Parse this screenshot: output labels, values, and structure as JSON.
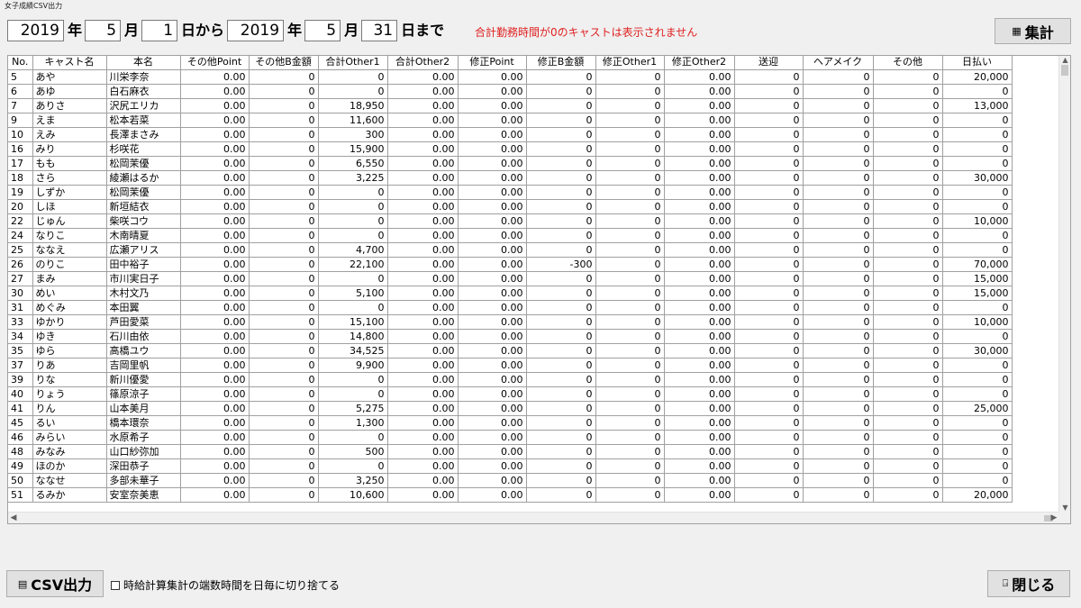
{
  "window": {
    "title": "女子成績CSV出力"
  },
  "date_range": {
    "from_year": "2019",
    "from_year_unit": "年",
    "from_month": "5",
    "from_month_unit": "月",
    "from_day": "1",
    "from_day_unit": "日から",
    "to_year": "2019",
    "to_year_unit": "年",
    "to_month": "5",
    "to_month_unit": "月",
    "to_day": "31",
    "to_day_unit": "日まで"
  },
  "warning": {
    "text": "合計勤務時間が0のキャストは表示されません",
    "color": "#e02020"
  },
  "buttons": {
    "aggregate": "集計",
    "csv": "CSV出力",
    "close": "閉じる"
  },
  "footer": {
    "truncate_label": "時給計算集計の端数時間を日毎に切り捨てる",
    "truncate_checked": false
  },
  "table": {
    "columns": [
      "No.",
      "キャスト名",
      "本名",
      "その他Point",
      "その他B金額",
      "合計Other1",
      "合計Other2",
      "修正Point",
      "修正B金額",
      "修正Other1",
      "修正Other2",
      "送迎",
      "ヘアメイク",
      "その他",
      "日払い"
    ],
    "rows": [
      [
        "5",
        "あや",
        "川栄李奈",
        "0.00",
        "0",
        "0",
        "0.00",
        "0.00",
        "0",
        "0",
        "0.00",
        "0",
        "0",
        "0",
        "20,000"
      ],
      [
        "6",
        "あゆ",
        "白石麻衣",
        "0.00",
        "0",
        "0",
        "0.00",
        "0.00",
        "0",
        "0",
        "0.00",
        "0",
        "0",
        "0",
        "0"
      ],
      [
        "7",
        "ありさ",
        "沢尻エリカ",
        "0.00",
        "0",
        "18,950",
        "0.00",
        "0.00",
        "0",
        "0",
        "0.00",
        "0",
        "0",
        "0",
        "13,000"
      ],
      [
        "9",
        "えま",
        "松本若菜",
        "0.00",
        "0",
        "11,600",
        "0.00",
        "0.00",
        "0",
        "0",
        "0.00",
        "0",
        "0",
        "0",
        "0"
      ],
      [
        "10",
        "えみ",
        "長澤まさみ",
        "0.00",
        "0",
        "300",
        "0.00",
        "0.00",
        "0",
        "0",
        "0.00",
        "0",
        "0",
        "0",
        "0"
      ],
      [
        "16",
        "みり",
        "杉咲花",
        "0.00",
        "0",
        "15,900",
        "0.00",
        "0.00",
        "0",
        "0",
        "0.00",
        "0",
        "0",
        "0",
        "0"
      ],
      [
        "17",
        "もも",
        "松岡茉優",
        "0.00",
        "0",
        "6,550",
        "0.00",
        "0.00",
        "0",
        "0",
        "0.00",
        "0",
        "0",
        "0",
        "0"
      ],
      [
        "18",
        "さら",
        "綾瀬はるか",
        "0.00",
        "0",
        "3,225",
        "0.00",
        "0.00",
        "0",
        "0",
        "0.00",
        "0",
        "0",
        "0",
        "30,000"
      ],
      [
        "19",
        "しずか",
        "松岡茉優",
        "0.00",
        "0",
        "0",
        "0.00",
        "0.00",
        "0",
        "0",
        "0.00",
        "0",
        "0",
        "0",
        "0"
      ],
      [
        "20",
        "しほ",
        "新垣結衣",
        "0.00",
        "0",
        "0",
        "0.00",
        "0.00",
        "0",
        "0",
        "0.00",
        "0",
        "0",
        "0",
        "0"
      ],
      [
        "22",
        "じゅん",
        "柴咲コウ",
        "0.00",
        "0",
        "0",
        "0.00",
        "0.00",
        "0",
        "0",
        "0.00",
        "0",
        "0",
        "0",
        "10,000"
      ],
      [
        "24",
        "なりこ",
        "木南晴夏",
        "0.00",
        "0",
        "0",
        "0.00",
        "0.00",
        "0",
        "0",
        "0.00",
        "0",
        "0",
        "0",
        "0"
      ],
      [
        "25",
        "ななえ",
        "広瀬アリス",
        "0.00",
        "0",
        "4,700",
        "0.00",
        "0.00",
        "0",
        "0",
        "0.00",
        "0",
        "0",
        "0",
        "0"
      ],
      [
        "26",
        "のりこ",
        "田中裕子",
        "0.00",
        "0",
        "22,100",
        "0.00",
        "0.00",
        "-300",
        "0",
        "0.00",
        "0",
        "0",
        "0",
        "70,000"
      ],
      [
        "27",
        "まみ",
        "市川実日子",
        "0.00",
        "0",
        "0",
        "0.00",
        "0.00",
        "0",
        "0",
        "0.00",
        "0",
        "0",
        "0",
        "15,000"
      ],
      [
        "30",
        "めい",
        "木村文乃",
        "0.00",
        "0",
        "5,100",
        "0.00",
        "0.00",
        "0",
        "0",
        "0.00",
        "0",
        "0",
        "0",
        "15,000"
      ],
      [
        "31",
        "めぐみ",
        "本田翼",
        "0.00",
        "0",
        "0",
        "0.00",
        "0.00",
        "0",
        "0",
        "0.00",
        "0",
        "0",
        "0",
        "0"
      ],
      [
        "33",
        "ゆかり",
        "芦田愛菜",
        "0.00",
        "0",
        "15,100",
        "0.00",
        "0.00",
        "0",
        "0",
        "0.00",
        "0",
        "0",
        "0",
        "10,000"
      ],
      [
        "34",
        "ゆき",
        "石川由依",
        "0.00",
        "0",
        "14,800",
        "0.00",
        "0.00",
        "0",
        "0",
        "0.00",
        "0",
        "0",
        "0",
        "0"
      ],
      [
        "35",
        "ゆら",
        "高橋ユウ",
        "0.00",
        "0",
        "34,525",
        "0.00",
        "0.00",
        "0",
        "0",
        "0.00",
        "0",
        "0",
        "0",
        "30,000"
      ],
      [
        "37",
        "りあ",
        "吉岡里帆",
        "0.00",
        "0",
        "9,900",
        "0.00",
        "0.00",
        "0",
        "0",
        "0.00",
        "0",
        "0",
        "0",
        "0"
      ],
      [
        "39",
        "りな",
        "新川優愛",
        "0.00",
        "0",
        "0",
        "0.00",
        "0.00",
        "0",
        "0",
        "0.00",
        "0",
        "0",
        "0",
        "0"
      ],
      [
        "40",
        "りょう",
        "篠原涼子",
        "0.00",
        "0",
        "0",
        "0.00",
        "0.00",
        "0",
        "0",
        "0.00",
        "0",
        "0",
        "0",
        "0"
      ],
      [
        "41",
        "りん",
        "山本美月",
        "0.00",
        "0",
        "5,275",
        "0.00",
        "0.00",
        "0",
        "0",
        "0.00",
        "0",
        "0",
        "0",
        "25,000"
      ],
      [
        "45",
        "るい",
        "橋本環奈",
        "0.00",
        "0",
        "1,300",
        "0.00",
        "0.00",
        "0",
        "0",
        "0.00",
        "0",
        "0",
        "0",
        "0"
      ],
      [
        "46",
        "みらい",
        "水原希子",
        "0.00",
        "0",
        "0",
        "0.00",
        "0.00",
        "0",
        "0",
        "0.00",
        "0",
        "0",
        "0",
        "0"
      ],
      [
        "48",
        "みなみ",
        "山口紗弥加",
        "0.00",
        "0",
        "500",
        "0.00",
        "0.00",
        "0",
        "0",
        "0.00",
        "0",
        "0",
        "0",
        "0"
      ],
      [
        "49",
        "ほのか",
        "深田恭子",
        "0.00",
        "0",
        "0",
        "0.00",
        "0.00",
        "0",
        "0",
        "0.00",
        "0",
        "0",
        "0",
        "0"
      ],
      [
        "50",
        "ななせ",
        "多部未華子",
        "0.00",
        "0",
        "3,250",
        "0.00",
        "0.00",
        "0",
        "0",
        "0.00",
        "0",
        "0",
        "0",
        "0"
      ],
      [
        "51",
        "るみか",
        "安室奈美恵",
        "0.00",
        "0",
        "10,600",
        "0.00",
        "0.00",
        "0",
        "0",
        "0.00",
        "0",
        "0",
        "0",
        "20,000"
      ]
    ]
  }
}
